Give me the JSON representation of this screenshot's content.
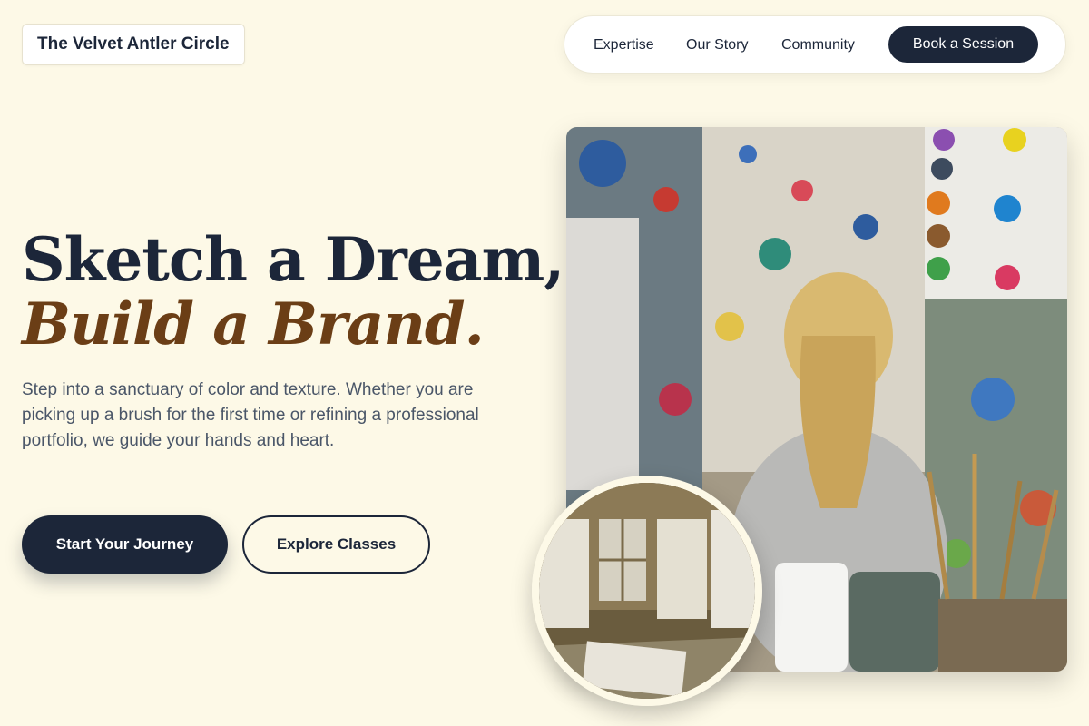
{
  "brand": {
    "name": "The Velvet Antler Circle"
  },
  "nav": {
    "links": [
      "Expertise",
      "Our Story",
      "Community"
    ],
    "cta_label": "Book a Session"
  },
  "hero": {
    "title_line1": "Sketch a Dream,",
    "title_line2": "Build a Brand.",
    "description": "Step into a sanctuary of color and texture. Whether you are picking up a brush for the first time or refining a professional portfolio, we guide your hands and heart.",
    "primary_button": "Start Your Journey",
    "secondary_button": "Explore Classes"
  },
  "images": {
    "main": {
      "subject": "child-painting-in-studio"
    },
    "inset": {
      "subject": "art-studio-room"
    }
  },
  "colors": {
    "background": "#fdf9e7",
    "navy": "#1c2639",
    "accent_brown": "#6b3e16",
    "body_text": "#4a5668"
  }
}
